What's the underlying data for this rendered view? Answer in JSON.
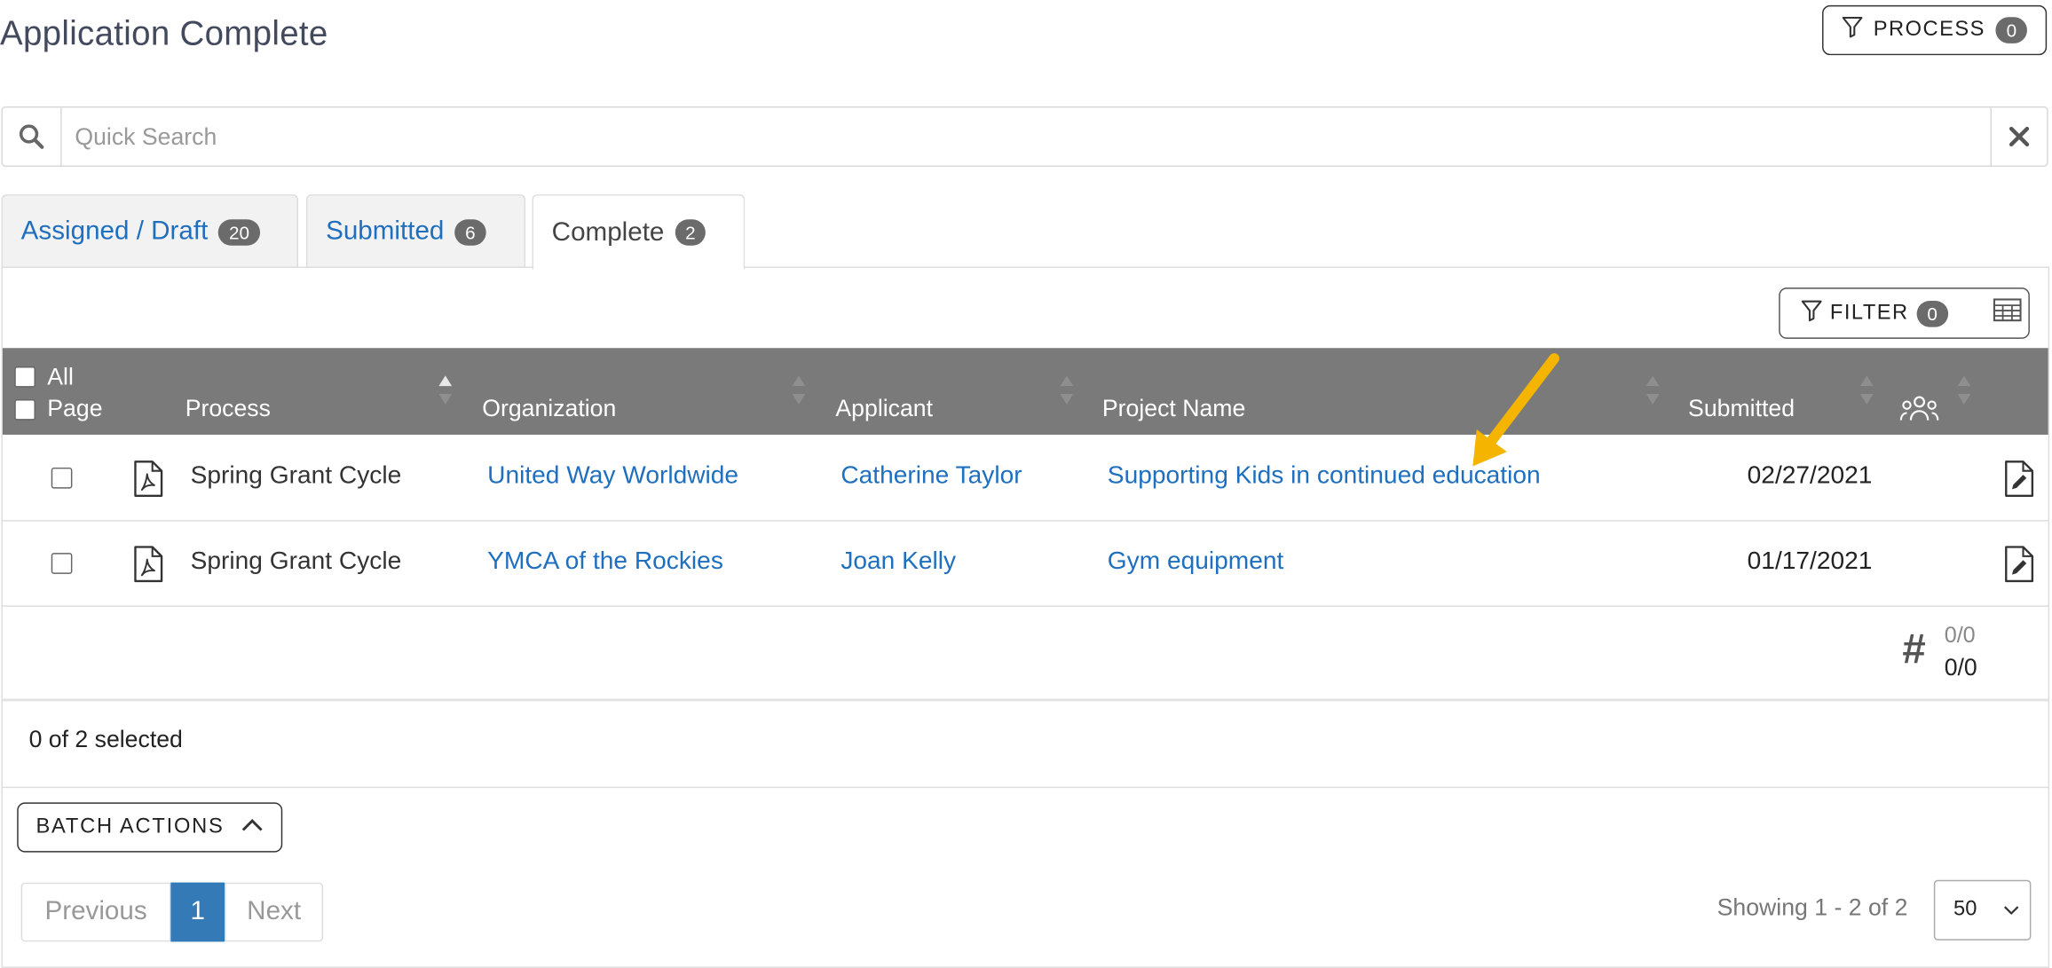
{
  "header": {
    "title": "Application Complete",
    "process_label": "PROCESS",
    "process_count": "0"
  },
  "search": {
    "placeholder": "Quick Search"
  },
  "tabs": [
    {
      "label": "Assigned / Draft",
      "count": "20"
    },
    {
      "label": "Submitted",
      "count": "6"
    },
    {
      "label": "Complete",
      "count": "2"
    }
  ],
  "toolbar": {
    "filter_label": "FILTER",
    "filter_count": "0"
  },
  "table": {
    "select_all_label": "All",
    "select_page_label": "Page",
    "columns": [
      "Process",
      "Organization",
      "Applicant",
      "Project Name",
      "Submitted"
    ],
    "rows": [
      {
        "process": "Spring Grant Cycle",
        "organization": "United Way Worldwide",
        "applicant": "Catherine Taylor",
        "project_name": "Supporting Kids in continued education",
        "submitted": "02/27/2021"
      },
      {
        "process": "Spring Grant Cycle",
        "organization": "YMCA of the Rockies",
        "applicant": "Joan Kelly",
        "project_name": "Gym equipment",
        "submitted": "01/17/2021"
      }
    ],
    "count_symbol": "#",
    "count_top": "0/0",
    "count_bottom": "0/0"
  },
  "selection": {
    "text": "0 of 2 selected"
  },
  "batch": {
    "label": "BATCH ACTIONS"
  },
  "pagination": {
    "previous": "Previous",
    "current": "1",
    "next": "Next",
    "showing": "Showing 1 - 2 of 2",
    "page_size": "50"
  },
  "colors": {
    "link": "#1f6fbf",
    "header_bg": "#7a7a7a",
    "active_page": "#337ab7",
    "annotation_arrow": "#f4b400"
  }
}
